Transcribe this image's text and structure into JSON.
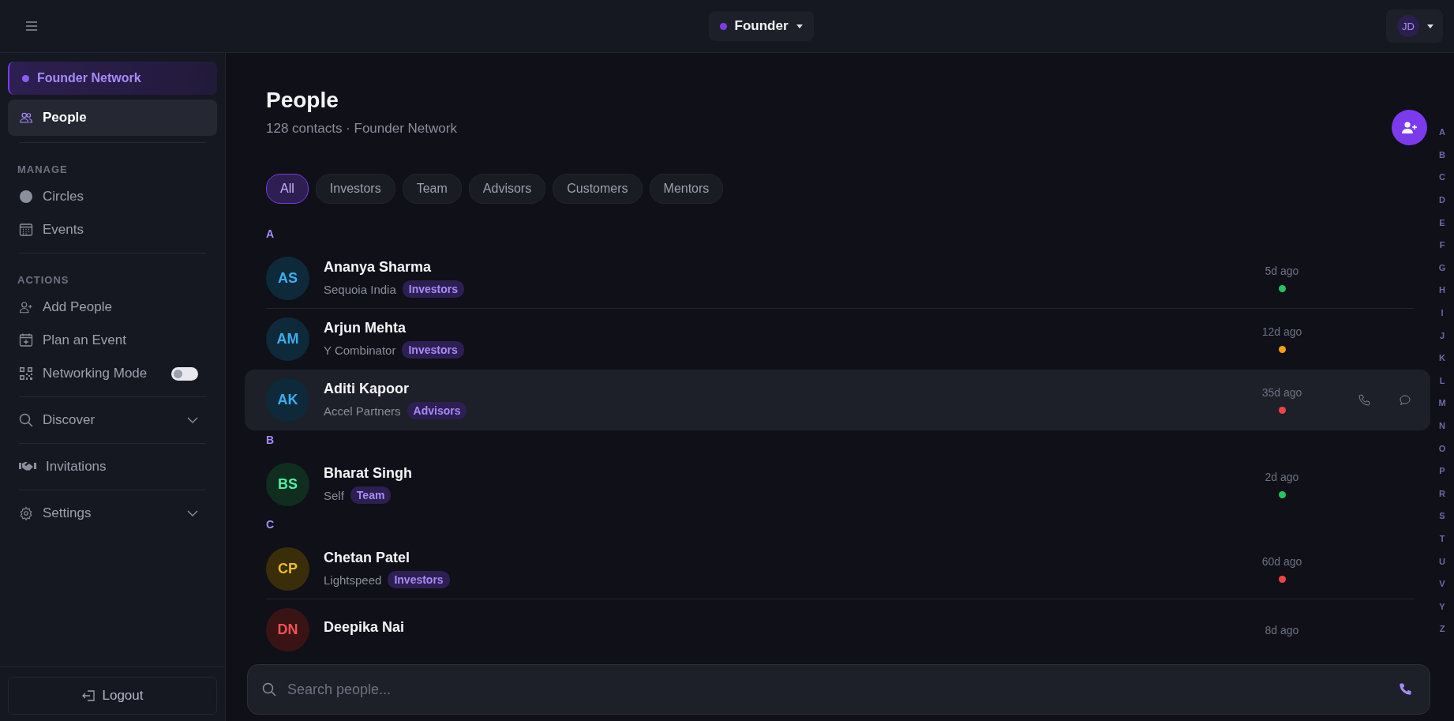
{
  "topbar": {
    "workspace": {
      "label": "Founder",
      "color": "#7c3aed"
    },
    "user": {
      "initials": "JD"
    }
  },
  "sidebar": {
    "workspace": {
      "label": "Founder Network",
      "selected": true
    },
    "items": [
      {
        "kind": "link",
        "label": "People",
        "selected": true
      },
      {
        "kind": "divider"
      },
      {
        "kind": "heading",
        "label": "MANAGE"
      },
      {
        "kind": "link",
        "label": "Circles",
        "selected": false
      },
      {
        "kind": "link",
        "label": "Events",
        "selected": false
      },
      {
        "kind": "divider"
      },
      {
        "kind": "heading",
        "label": "ACTIONS"
      },
      {
        "kind": "link",
        "label": "Add People",
        "selected": false
      },
      {
        "kind": "link",
        "label": "Plan an Event",
        "selected": false
      },
      {
        "kind": "toggle",
        "label": "Networking Mode",
        "on": false
      },
      {
        "kind": "divider"
      },
      {
        "kind": "expandable",
        "label": "Discover",
        "expanded": false
      },
      {
        "kind": "divider"
      },
      {
        "kind": "link",
        "label": "Invitations",
        "selected": false
      },
      {
        "kind": "divider"
      },
      {
        "kind": "expandable",
        "label": "Settings",
        "expanded": false
      }
    ],
    "logout": "Logout"
  },
  "page": {
    "title": "People",
    "subtitle": "128 contacts · Founder Network"
  },
  "filters": [
    {
      "label": "All",
      "selected": true
    },
    {
      "label": "Investors",
      "selected": false
    },
    {
      "label": "Team",
      "selected": false
    },
    {
      "label": "Advisors",
      "selected": false
    },
    {
      "label": "Customers",
      "selected": false
    },
    {
      "label": "Mentors",
      "selected": false
    }
  ],
  "sections": [
    {
      "letter": "A",
      "contacts": [
        {
          "avatar": {
            "initials": "AS",
            "color": "#0e2a3a"
          },
          "name": "Ananya Sharma",
          "company": "Sequoia India",
          "tag": "Investors",
          "last_seen": "5d ago",
          "color": "#22c55e",
          "selected": false
        },
        {
          "avatar": {
            "initials": "AM",
            "color": "#0e2a3a"
          },
          "name": "Arjun Mehta",
          "company": "Y Combinator",
          "tag": "Investors",
          "last_seen": "12d ago",
          "color": "#f59e0b",
          "selected": false
        },
        {
          "avatar": {
            "initials": "AK",
            "color": "#0e2a3a"
          },
          "name": "Aditi Kapoor",
          "company": "Accel Partners",
          "tag": "Advisors",
          "last_seen": "35d ago",
          "color": "#ef4444",
          "selected": true
        }
      ]
    },
    {
      "letter": "B",
      "contacts": [
        {
          "avatar": {
            "initials": "BS",
            "color": "#0f2e1f"
          },
          "name": "Bharat Singh",
          "company": "Self",
          "tag": "Team",
          "last_seen": "2d ago",
          "color": "#22c55e",
          "selected": false
        }
      ]
    },
    {
      "letter": "C",
      "contacts": [
        {
          "avatar": {
            "initials": "CP",
            "color": "#3a2e0a"
          },
          "name": "Chetan Patel",
          "company": "Lightspeed",
          "tag": "Investors",
          "last_seen": "60d ago",
          "color": "#ef4444",
          "selected": false
        },
        {
          "avatar": {
            "initials": "DN",
            "color": "#3a1414"
          },
          "name": "Deepika Nai",
          "last_seen": "8d ago",
          "selected": false
        }
      ]
    }
  ],
  "alphabet": [
    "A",
    "B",
    "C",
    "D",
    "E",
    "F",
    "G",
    "H",
    "I",
    "J",
    "K",
    "L",
    "M",
    "N",
    "O",
    "P",
    "R",
    "S",
    "T",
    "U",
    "V",
    "Y",
    "Z"
  ],
  "search": {
    "placeholder": "Search people..."
  }
}
